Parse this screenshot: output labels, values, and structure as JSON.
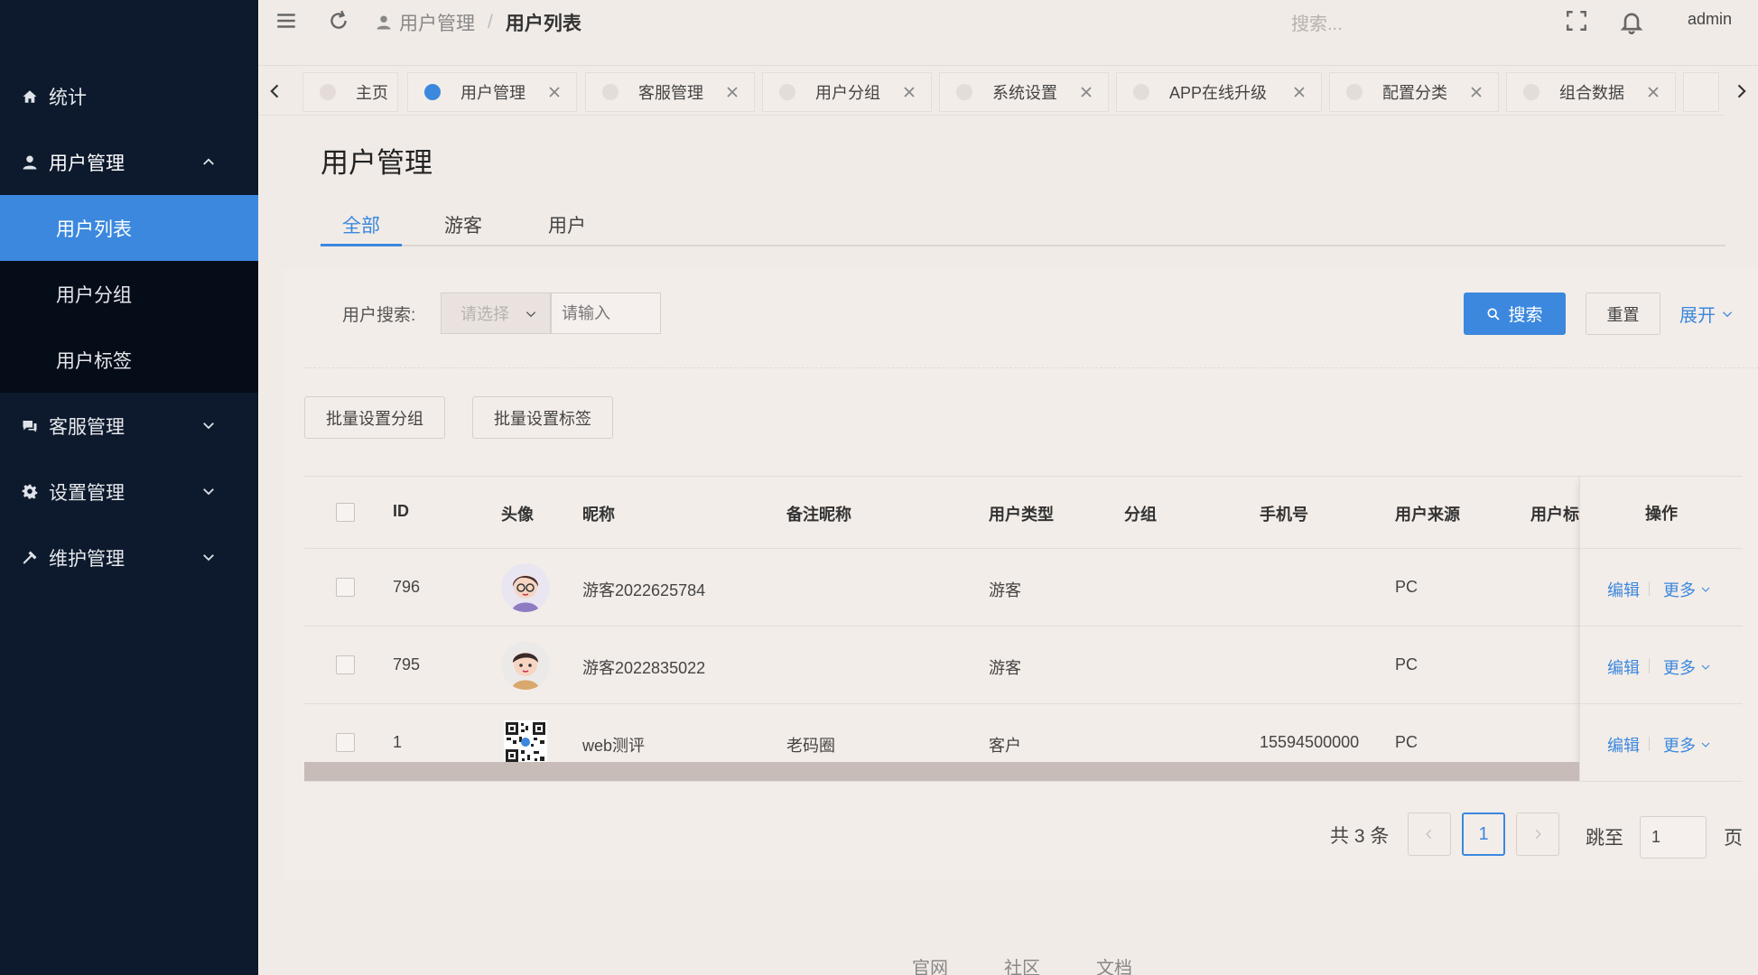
{
  "sidebar": {
    "items": [
      {
        "label": "统计"
      },
      {
        "label": "用户管理"
      },
      {
        "label": "客服管理"
      },
      {
        "label": "设置管理"
      },
      {
        "label": "维护管理"
      }
    ],
    "sub_items": [
      {
        "label": "用户列表"
      },
      {
        "label": "用户分组"
      },
      {
        "label": "用户标签"
      }
    ]
  },
  "header": {
    "breadcrumb": [
      "用户管理",
      "用户列表"
    ],
    "search_placeholder": "搜索...",
    "user": "admin"
  },
  "tabs": [
    {
      "label": "主页"
    },
    {
      "label": "用户管理"
    },
    {
      "label": "客服管理"
    },
    {
      "label": "用户分组"
    },
    {
      "label": "系统设置"
    },
    {
      "label": "APP在线升级"
    },
    {
      "label": "配置分类"
    },
    {
      "label": "组合数据"
    }
  ],
  "page": {
    "title": "用户管理",
    "subtabs": [
      "全部",
      "游客",
      "用户"
    ]
  },
  "filter": {
    "label": "用户搜索:",
    "select_placeholder": "请选择",
    "input_placeholder": "请输入",
    "search_button": "搜索",
    "reset_button": "重置",
    "expand": "展开"
  },
  "batch": {
    "set_group": "批量设置分组",
    "set_tag": "批量设置标签"
  },
  "table": {
    "columns": [
      "ID",
      "头像",
      "昵称",
      "备注昵称",
      "用户类型",
      "分组",
      "手机号",
      "用户来源",
      "用户标",
      "操作"
    ],
    "rows": [
      {
        "id": "796",
        "nickname": "游客2022625784",
        "remark": "",
        "type": "游客",
        "group": "",
        "phone": "",
        "source": "PC",
        "avatar": "girl-avatar"
      },
      {
        "id": "795",
        "nickname": "游客2022835022",
        "remark": "",
        "type": "游客",
        "group": "",
        "phone": "",
        "source": "PC",
        "avatar": "boy-avatar"
      },
      {
        "id": "1",
        "nickname": "web测评",
        "remark": "老码圈",
        "type": "客户",
        "group": "",
        "phone": "15594500000",
        "source": "PC",
        "avatar": "qr-avatar"
      }
    ],
    "op_edit": "编辑",
    "op_more": "更多"
  },
  "pagination": {
    "total": "共 3 条",
    "current": "1",
    "jump_label": "跳至",
    "jump_value": "1",
    "page_suffix": "页"
  },
  "footer": [
    "官网",
    "社区",
    "文档"
  ],
  "colors": {
    "accent": "#3b88de",
    "sidebar_bg": "#0d1a2d"
  }
}
